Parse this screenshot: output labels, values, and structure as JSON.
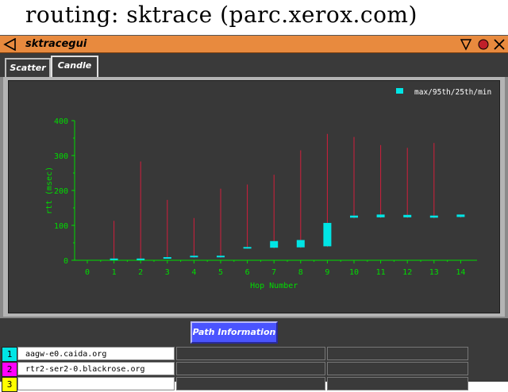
{
  "banner": {
    "text": "routing:  sktrace  (parc.xerox.com)"
  },
  "window": {
    "title": "sktracegui"
  },
  "tabs": [
    {
      "label": "Scatter",
      "active": false
    },
    {
      "label": "Candle",
      "active": true
    }
  ],
  "chart_data": {
    "type": "candlestick",
    "legend": "max/95th/25th/min",
    "legend_position": "top-right",
    "xlabel": "Hop Number",
    "ylabel": "rtt (msec)",
    "xlim": [
      0,
      14
    ],
    "ylim": [
      0,
      400
    ],
    "x_ticks": [
      "0",
      "1",
      "2",
      "3",
      "4",
      "5",
      "6",
      "7",
      "8",
      "9",
      "10",
      "11",
      "12",
      "13",
      "14"
    ],
    "y_ticks": [
      "0",
      "100",
      "200",
      "300",
      "400"
    ],
    "grid": false,
    "colors": {
      "whisker": "#d21e3c",
      "box": "#00e5e5",
      "axis": "#00dd00",
      "background": "#383838"
    },
    "points": [
      {
        "hop": 1,
        "max": 113,
        "p95": 5,
        "p25": 2,
        "min": 1
      },
      {
        "hop": 2,
        "max": 283,
        "p95": 5,
        "p25": 2,
        "min": 1
      },
      {
        "hop": 3,
        "max": 173,
        "p95": 9,
        "p25": 6,
        "min": 5
      },
      {
        "hop": 4,
        "max": 121,
        "p95": 13,
        "p25": 9,
        "min": 7
      },
      {
        "hop": 5,
        "max": 205,
        "p95": 13,
        "p25": 9,
        "min": 7
      },
      {
        "hop": 6,
        "max": 217,
        "p95": 38,
        "p25": 35,
        "min": 33
      },
      {
        "hop": 7,
        "max": 245,
        "p95": 55,
        "p25": 36,
        "min": 34
      },
      {
        "hop": 8,
        "max": 315,
        "p95": 58,
        "p25": 37,
        "min": 35
      },
      {
        "hop": 9,
        "max": 362,
        "p95": 107,
        "p25": 40,
        "min": 38
      },
      {
        "hop": 10,
        "max": 353,
        "p95": 128,
        "p25": 122,
        "min": 120
      },
      {
        "hop": 11,
        "max": 330,
        "p95": 131,
        "p25": 123,
        "min": 121
      },
      {
        "hop": 12,
        "max": 322,
        "p95": 130,
        "p25": 123,
        "min": 121
      },
      {
        "hop": 13,
        "max": 336,
        "p95": 128,
        "p25": 122,
        "min": 120
      },
      {
        "hop": 14,
        "max": 131,
        "p95": 131,
        "p25": 124,
        "min": 122
      }
    ]
  },
  "path_button": {
    "label": "Path Information"
  },
  "hops": [
    {
      "num": "1",
      "name": "aagw-e0.caida.org",
      "color": "#00e5e5"
    },
    {
      "num": "2",
      "name": "rtr2-ser2-0.blackrose.org",
      "color": "#ff00ff"
    },
    {
      "num": "3",
      "name": "",
      "color": "#ffff00"
    }
  ]
}
